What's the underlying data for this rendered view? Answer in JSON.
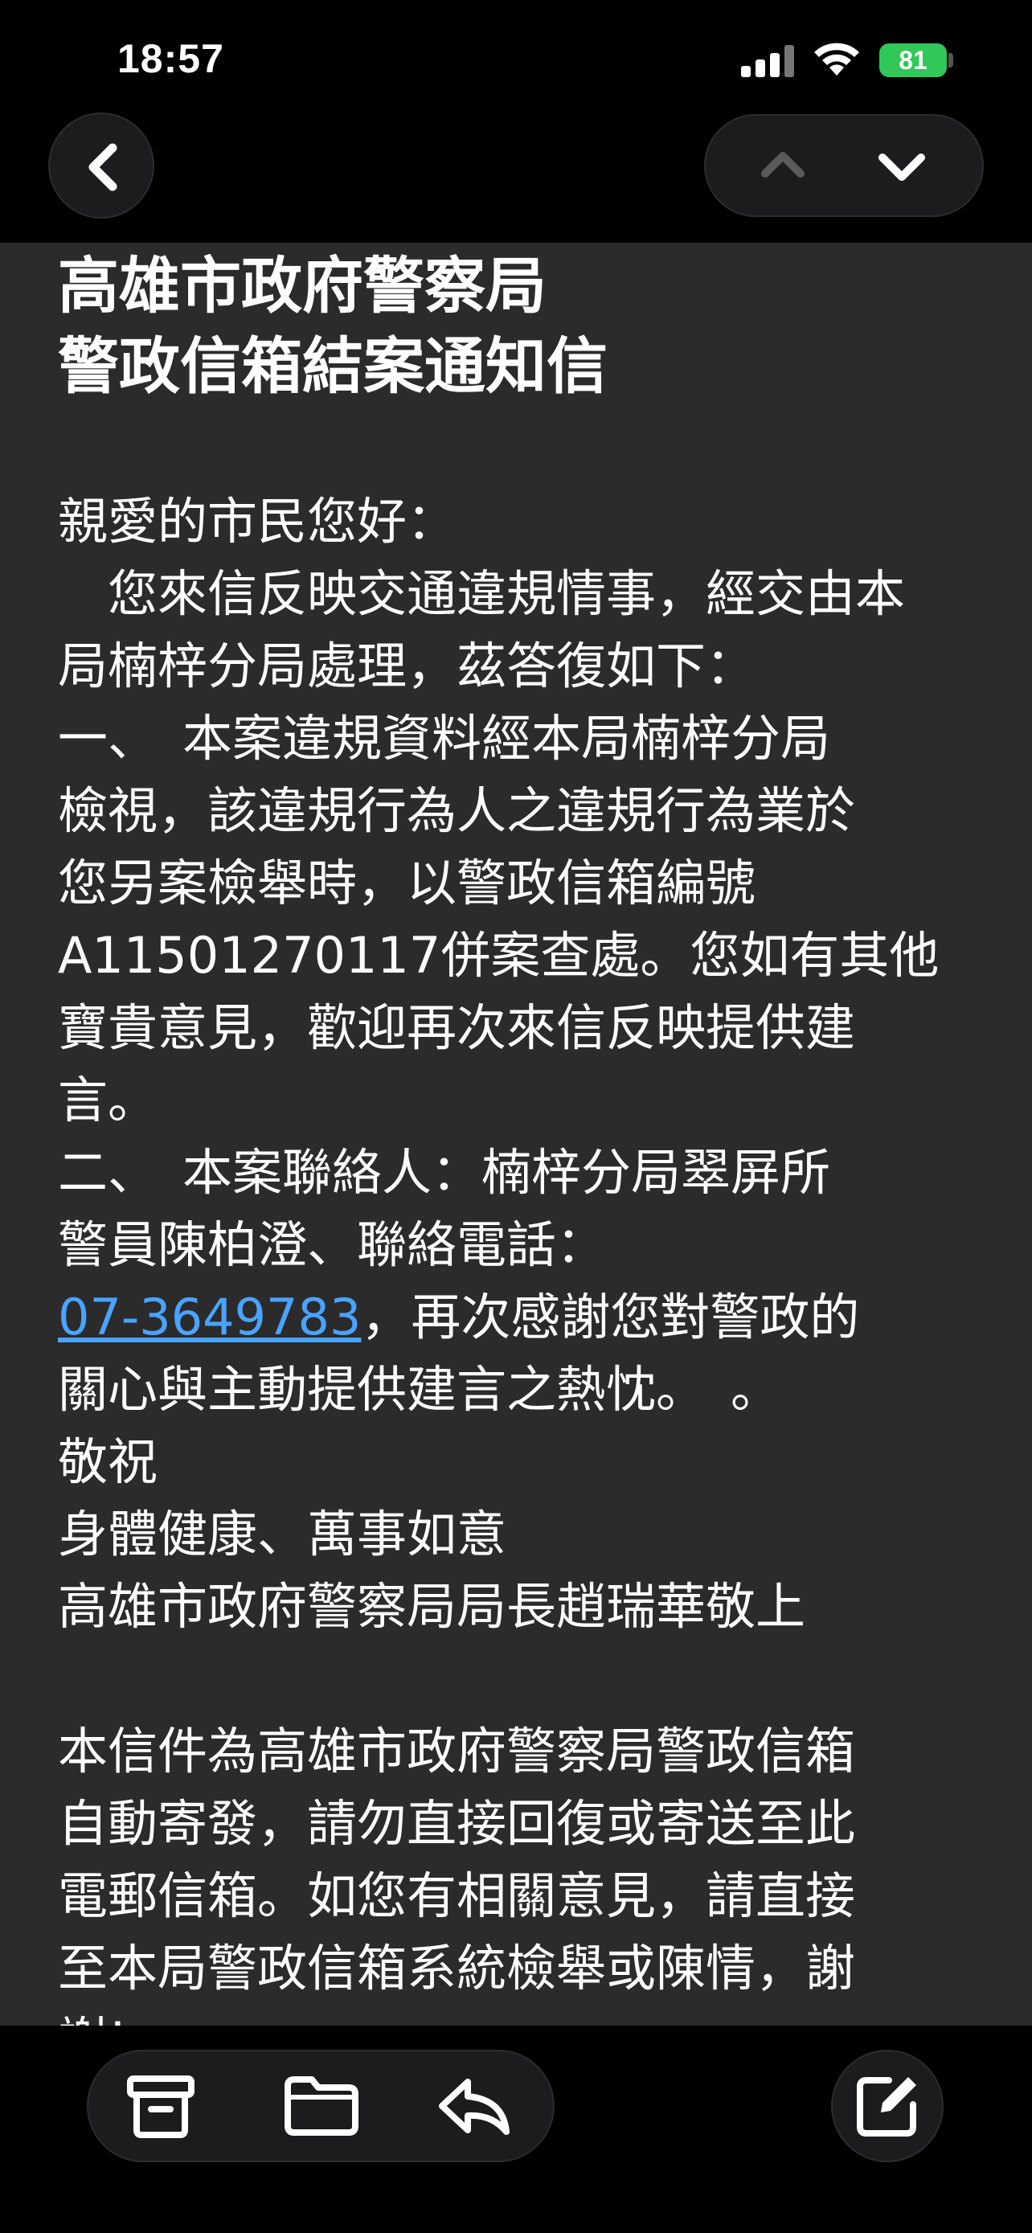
{
  "status_bar": {
    "time": "18:57",
    "battery": "81"
  },
  "nav": {
    "back_icon": "chevron-left-icon",
    "prev_icon": "chevron-up-icon",
    "next_icon": "chevron-down-icon"
  },
  "mail": {
    "title_lines": [
      "高雄市政府警察局",
      "警政信箱結案通知信"
    ],
    "body": {
      "greeting": "親愛的市民您好：",
      "intro_1": "　您來信反映交通違規情事，經交由本",
      "intro_2": "局楠梓分局處理，茲答復如下：",
      "p1_1": "一、　本案違規資料經本局楠梓分局",
      "p1_2": "檢視，該違規行為人之違規行為業於",
      "p1_3": "您另案檢舉時，以警政信箱編號",
      "p1_4": "A11501270117併案查處。您如有其他",
      "p1_5": "寶貴意見，歡迎再次來信反映提供建",
      "p1_6": "言。",
      "p2_1": "二、　本案聯絡人：楠梓分局翠屏所",
      "p2_2": "警員陳柏澄、聯絡電話：",
      "p2_phone": "07-3649783",
      "p2_3": "，再次感謝您對警政的",
      "p2_4": "關心與主動提供建言之熱忱。　。",
      "closing_1": "敬祝",
      "closing_2": "身體健康、萬事如意",
      "signature": "高雄市政府警察局局長趙瑞華敬上",
      "notice_1": "本信件為高雄市政府警察局警政信箱",
      "notice_2": "自動寄發，請勿直接回復或寄送至此",
      "notice_3": "電郵信箱。如您有相關意見，請直接",
      "notice_4": "至本局警政信箱系統檢舉或陳情，謝",
      "notice_5": "謝!"
    }
  },
  "toolbar": {
    "archive_icon": "archive-icon",
    "folder_icon": "folder-icon",
    "reply_icon": "reply-icon",
    "compose_icon": "compose-icon"
  },
  "colors": {
    "background": "#2b2b2b",
    "link": "#4aa3ff",
    "battery": "#32c759"
  }
}
